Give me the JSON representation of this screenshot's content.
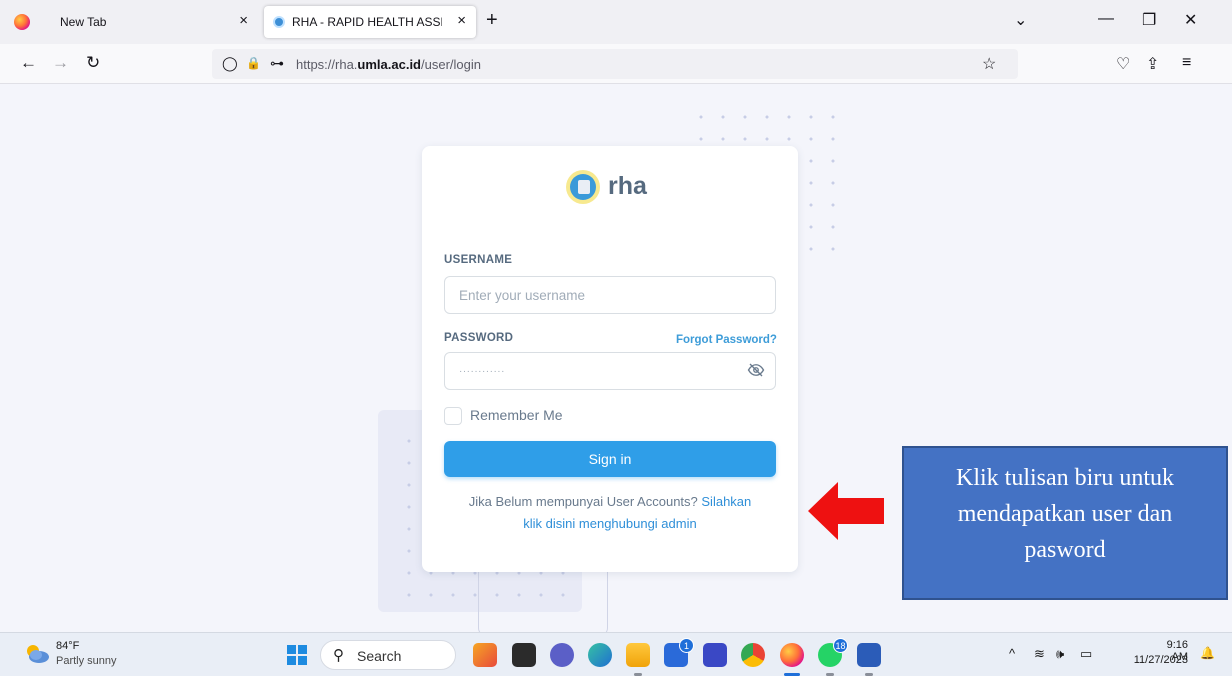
{
  "browser": {
    "tabs": [
      {
        "title": "New Tab",
        "active": false
      },
      {
        "title": "RHA - RAPID HEALTH ASSESSMENT",
        "active": true
      }
    ],
    "tab_close_glyph": "×",
    "new_tab_glyph": "+",
    "window_controls": {
      "list_all_tabs": "⌄",
      "minimize": "—",
      "restore": "❐",
      "close": "✕"
    },
    "url": {
      "prefix": "https://rha.",
      "domain": "umla.ac.id",
      "path": "/user/login"
    },
    "nav_glyphs": {
      "back": "←",
      "forward": "→",
      "reload": "↻",
      "shield": "◯",
      "lock": "🔒",
      "key": "⊶",
      "bookmark": "☆",
      "pocket": "♡",
      "extensions": "⇪",
      "menu": "≡"
    }
  },
  "login": {
    "brand": "rha",
    "username_label": "USERNAME",
    "username_placeholder": "Enter your  username",
    "password_label": "PASSWORD",
    "forgot_password": "Forgot Password?",
    "password_value": "············",
    "remember_me": "Remember Me",
    "signin": "Sign in",
    "info_prefix": "Jika Belum mempunyai User Accounts?",
    "info_link_a": "Silahkan",
    "info_link_b": "klik disini menghubungi admin"
  },
  "annotation": {
    "lines": [
      "Klik tulisan biru untuk",
      "mendapatkan user dan",
      "pasword"
    ],
    "arrow_color": "#ee1111"
  },
  "taskbar": {
    "weather_temp": "84°F",
    "weather_desc": "Partly sunny",
    "search_label": "Search",
    "search_glyph": "⚲",
    "apps": [
      {
        "name": "widgets-app",
        "badge": ""
      },
      {
        "name": "file-explorer-app",
        "badge": ""
      },
      {
        "name": "meet-app",
        "badge": ""
      },
      {
        "name": "edge-app",
        "badge": ""
      },
      {
        "name": "folder-app",
        "badge": ""
      },
      {
        "name": "store-app",
        "badge": "1"
      },
      {
        "name": "editor-app",
        "badge": ""
      },
      {
        "name": "chrome-app",
        "badge": ""
      },
      {
        "name": "firefox-app",
        "badge": ""
      },
      {
        "name": "whatsapp-app",
        "badge": "18"
      },
      {
        "name": "word-app",
        "badge": ""
      }
    ],
    "tray_glyphs": {
      "chevron": "^",
      "wifi": "≋",
      "volume": "🕪",
      "battery": "▭",
      "bell": "🔔"
    },
    "time": "9:16 AM",
    "date": "11/27/2023"
  },
  "colors": {
    "primary": "#2f9ee8",
    "link": "#2f8fd8",
    "note_bg": "#4472c4",
    "arrow": "#ee1111"
  }
}
